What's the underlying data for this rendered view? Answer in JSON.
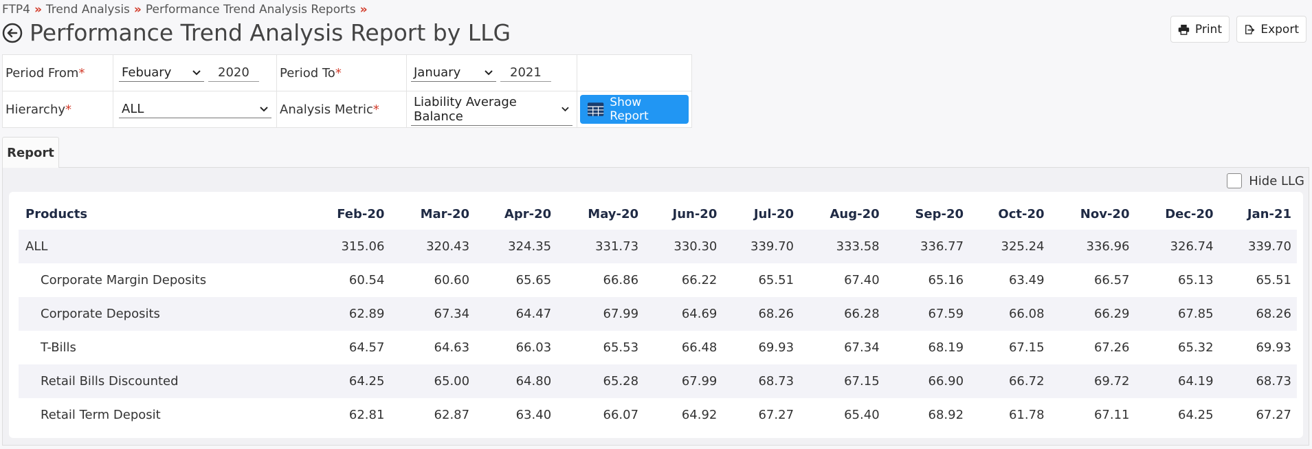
{
  "breadcrumb": [
    "FTP4",
    "Trend Analysis",
    "Performance Trend Analysis Reports"
  ],
  "breadcrumb_sep": "»",
  "page_title": "Performance Trend Analysis Report by LLG",
  "actions": {
    "print": "Print",
    "export": "Export"
  },
  "filters": {
    "period_from_label": "Period From",
    "period_from_month": "Febuary",
    "period_from_year": "2020",
    "period_to_label": "Period To",
    "period_to_month": "January",
    "period_to_year": "2021",
    "hierarchy_label": "Hierarchy",
    "hierarchy_value": "ALL",
    "metric_label": "Analysis Metric",
    "metric_value": "Liability Average Balance",
    "required_mark": "*",
    "show_report": "Show Report"
  },
  "tab_label": "Report",
  "hide_llg_label": "Hide LLG",
  "report": {
    "columns": [
      "Products",
      "Feb-20",
      "Mar-20",
      "Apr-20",
      "May-20",
      "Jun-20",
      "Jul-20",
      "Aug-20",
      "Sep-20",
      "Oct-20",
      "Nov-20",
      "Dec-20",
      "Jan-21"
    ],
    "rows": [
      {
        "name": "ALL",
        "level": 0,
        "values": [
          "315.06",
          "320.43",
          "324.35",
          "331.73",
          "330.30",
          "339.70",
          "333.58",
          "336.77",
          "325.24",
          "336.96",
          "326.74",
          "339.70"
        ]
      },
      {
        "name": "Corporate Margin Deposits",
        "level": 1,
        "values": [
          "60.54",
          "60.60",
          "65.65",
          "66.86",
          "66.22",
          "65.51",
          "67.40",
          "65.16",
          "63.49",
          "66.57",
          "65.13",
          "65.51"
        ]
      },
      {
        "name": "Corporate Deposits",
        "level": 1,
        "values": [
          "62.89",
          "67.34",
          "64.47",
          "67.99",
          "64.69",
          "68.26",
          "66.28",
          "67.59",
          "66.08",
          "66.29",
          "67.85",
          "68.26"
        ]
      },
      {
        "name": "T-Bills",
        "level": 1,
        "values": [
          "64.57",
          "64.63",
          "66.03",
          "65.53",
          "66.48",
          "69.93",
          "67.34",
          "68.19",
          "67.15",
          "67.26",
          "65.32",
          "69.93"
        ]
      },
      {
        "name": "Retail Bills Discounted",
        "level": 1,
        "values": [
          "64.25",
          "65.00",
          "64.80",
          "65.28",
          "67.99",
          "68.73",
          "67.15",
          "66.90",
          "66.72",
          "69.72",
          "64.19",
          "68.73"
        ]
      },
      {
        "name": "Retail Term Deposit",
        "level": 1,
        "values": [
          "62.81",
          "62.87",
          "63.40",
          "66.07",
          "64.92",
          "67.27",
          "65.40",
          "68.92",
          "61.78",
          "67.11",
          "64.25",
          "67.27"
        ]
      }
    ]
  },
  "colors": {
    "accent": "#2196f3",
    "required": "#d23b2a",
    "stripe": "#f3f3f8"
  },
  "icons": {
    "back": "arrow-left-circle-icon",
    "print": "printer-icon",
    "export": "export-icon",
    "table": "table-icon"
  }
}
